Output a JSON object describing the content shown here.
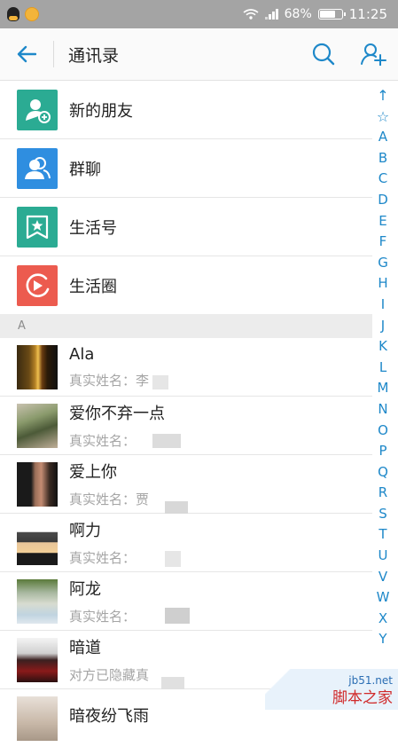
{
  "status_bar": {
    "battery": "68%",
    "time": "11:25"
  },
  "header": {
    "title": "通讯录",
    "icons": [
      "back-arrow-icon",
      "search-icon",
      "add-contact-icon"
    ]
  },
  "features": [
    {
      "label": "新的朋友",
      "icon": "new-friend-icon",
      "color": "#2bab93"
    },
    {
      "label": "群聊",
      "icon": "group-chat-icon",
      "color": "#2f8ee0"
    },
    {
      "label": "生活号",
      "icon": "life-account-icon",
      "color": "#2bab93"
    },
    {
      "label": "生活圈",
      "icon": "life-circle-icon",
      "color": "#ec5b4f"
    }
  ],
  "section": {
    "label": "A"
  },
  "contacts": [
    {
      "name": "Ala",
      "subtitle": "真实姓名：李"
    },
    {
      "name": "爱你不弃一点",
      "subtitle": "真实姓名："
    },
    {
      "name": "爱上你",
      "subtitle": "真实姓名：贾"
    },
    {
      "name": "啊力",
      "subtitle": "真实姓名："
    },
    {
      "name": "阿龙",
      "subtitle": "真实姓名："
    },
    {
      "name": "暗道",
      "subtitle": "对方已隐藏真"
    },
    {
      "name": "暗夜纷飞雨",
      "subtitle": ""
    }
  ],
  "alpha_index": [
    "↑",
    "☆",
    "A",
    "B",
    "C",
    "D",
    "E",
    "F",
    "G",
    "H",
    "I",
    "J",
    "K",
    "L",
    "M",
    "N",
    "O",
    "P",
    "Q",
    "R",
    "S",
    "T",
    "U",
    "V",
    "W",
    "X",
    "Y"
  ],
  "watermark": {
    "url": "jb51.net",
    "name": "脚本之家"
  },
  "colors": {
    "accent": "#1e88c9",
    "status_bar": "#a4a4a4"
  }
}
